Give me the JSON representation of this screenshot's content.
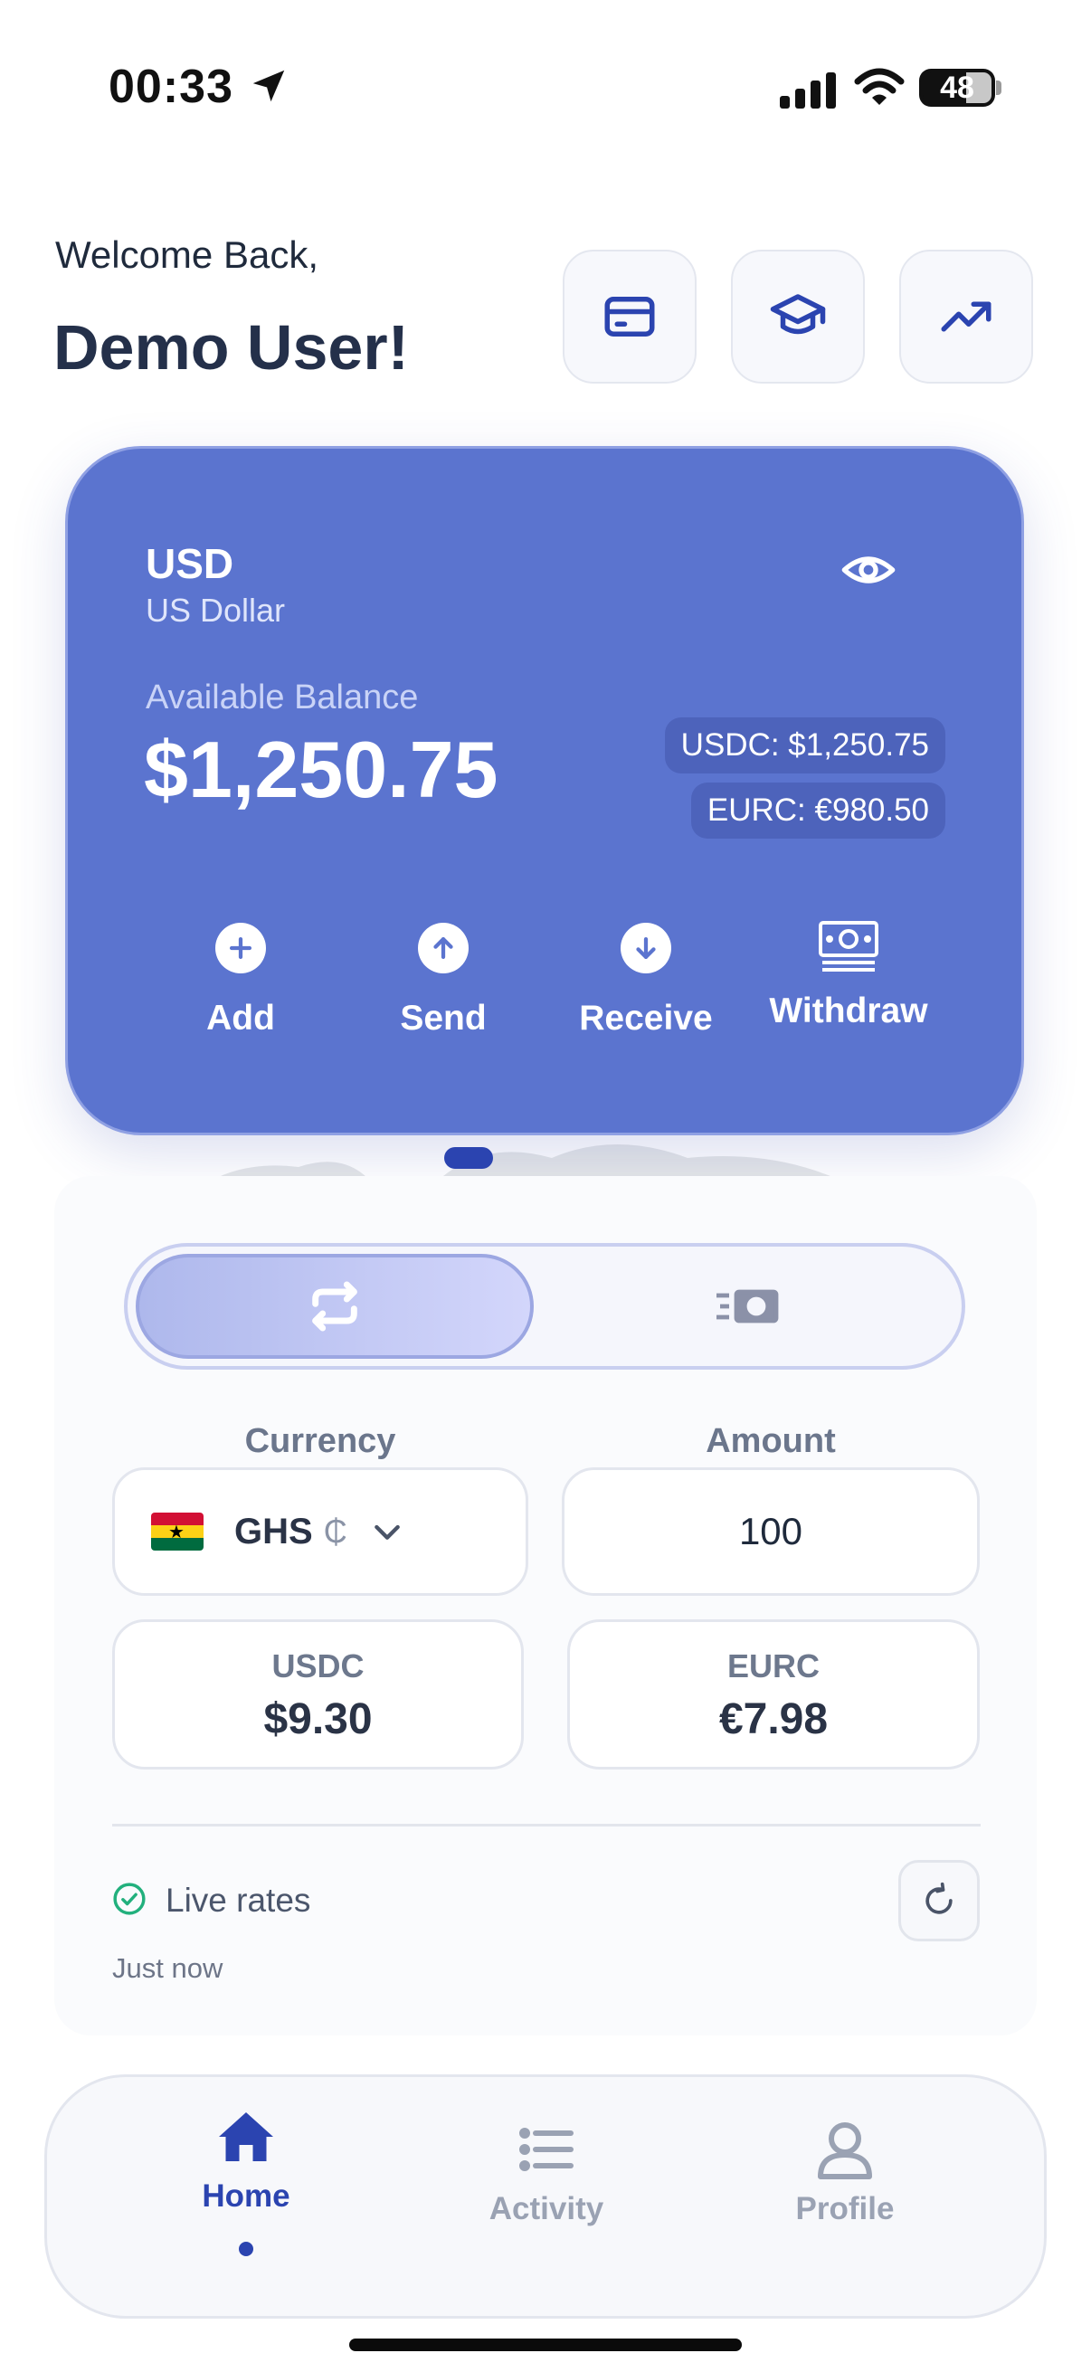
{
  "status_bar": {
    "time": "00:33",
    "battery": "48",
    "icons": [
      "location-arrow-icon",
      "signal-icon",
      "wifi-icon",
      "battery-icon"
    ]
  },
  "header": {
    "greeting": "Welcome Back,",
    "user_name": "Demo User!",
    "buttons": [
      {
        "icon": "card-icon"
      },
      {
        "icon": "graduation-cap-icon"
      },
      {
        "icon": "trending-up-icon"
      }
    ]
  },
  "balance_card": {
    "currency_code": "USD",
    "currency_name": "US Dollar",
    "balance_label": "Available Balance",
    "balance": "$1,250.75",
    "chips": [
      "USDC: $1,250.75",
      "EURC: €980.50"
    ],
    "actions": [
      {
        "label": "Add",
        "icon": "plus-icon"
      },
      {
        "label": "Send",
        "icon": "arrow-up-icon"
      },
      {
        "label": "Receive",
        "icon": "arrow-down-icon"
      },
      {
        "label": "Withdraw",
        "icon": "cash-icon"
      }
    ],
    "colors": {
      "card": "#5b74cf",
      "accent": "#2b44b0"
    }
  },
  "converter": {
    "tabs": [
      {
        "icon": "swap-icon",
        "active": true
      },
      {
        "icon": "fast-cash-icon",
        "active": false
      }
    ],
    "currency_label": "Currency",
    "amount_label": "Amount",
    "selected_currency": "GHS",
    "currency_symbol": "₵",
    "flag": "ghana-flag",
    "amount": "100",
    "results": [
      {
        "label": "USDC",
        "value": "$9.30"
      },
      {
        "label": "EURC",
        "value": "€7.98"
      }
    ],
    "live_label": "Live rates",
    "updated": "Just now"
  },
  "bottom_nav": {
    "items": [
      {
        "label": "Home",
        "icon": "home-icon",
        "active": true
      },
      {
        "label": "Activity",
        "icon": "list-icon",
        "active": false
      },
      {
        "label": "Profile",
        "icon": "user-icon",
        "active": false
      }
    ],
    "colors": {
      "active": "#2b44b0",
      "inactive": "#9aa2b3"
    }
  }
}
